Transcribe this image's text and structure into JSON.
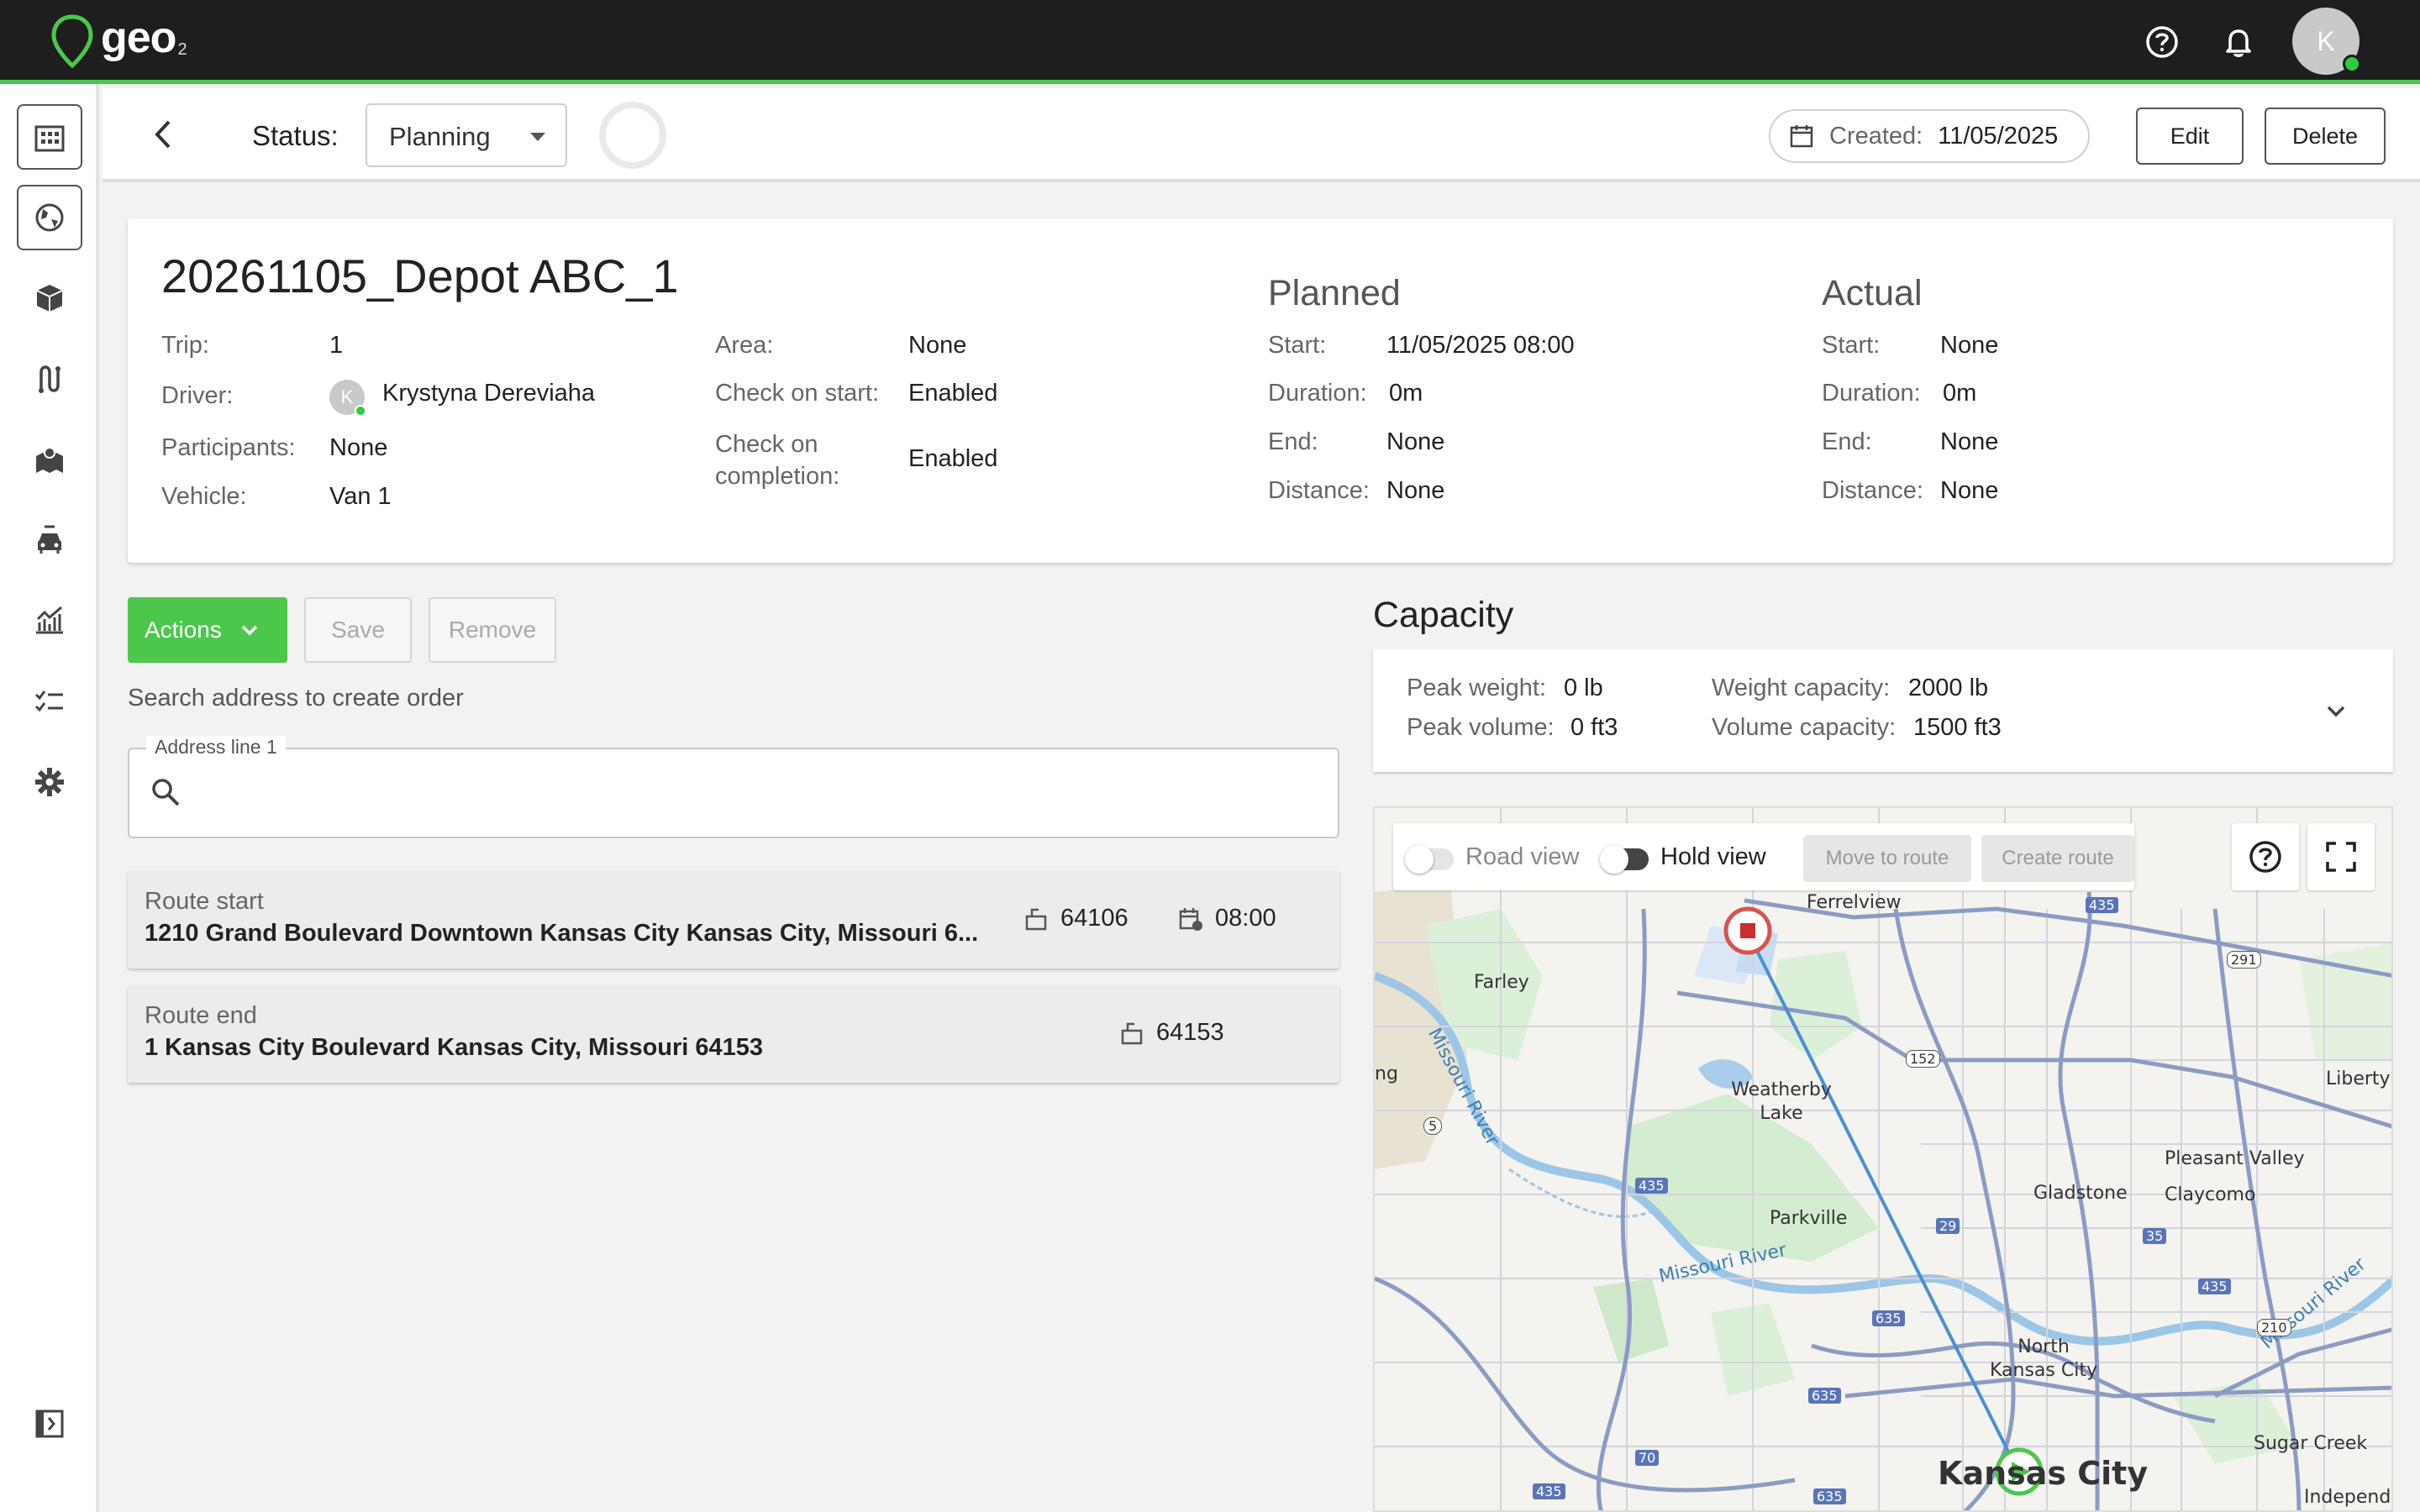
{
  "app": {
    "logo_text": "geo",
    "logo_sub": "2",
    "user_initial": "K"
  },
  "header": {
    "status_label": "Status:",
    "status_value": "Planning",
    "created_label": "Created:",
    "created_value": "11/05/2025",
    "edit_label": "Edit",
    "delete_label": "Delete"
  },
  "trip": {
    "title": "20261105_Depot ABC_1",
    "fields_left": [
      {
        "label": "Trip:",
        "value": "1"
      },
      {
        "label": "Driver:",
        "value": "Krystyna Dereviaha"
      },
      {
        "label": "Participants:",
        "value": "None"
      },
      {
        "label": "Vehicle:",
        "value": "Van 1"
      }
    ],
    "driver_initial": "K",
    "fields_mid": [
      {
        "label": "Area:",
        "value": "None"
      },
      {
        "label": "Check on start:",
        "value": "Enabled"
      },
      {
        "label": "Check on completion:",
        "value": "Enabled"
      }
    ],
    "planned": {
      "title": "Planned",
      "rows": [
        {
          "label": "Start:",
          "value": "11/05/2025 08:00"
        },
        {
          "label": "Duration:",
          "value": "0m"
        },
        {
          "label": "End:",
          "value": "None"
        },
        {
          "label": "Distance:",
          "value": "None"
        }
      ]
    },
    "actual": {
      "title": "Actual",
      "rows": [
        {
          "label": "Start:",
          "value": "None"
        },
        {
          "label": "Duration:",
          "value": "0m"
        },
        {
          "label": "End:",
          "value": "None"
        },
        {
          "label": "Distance:",
          "value": "None"
        }
      ]
    }
  },
  "order": {
    "actions_label": "Actions",
    "save_label": "Save",
    "remove_label": "Remove",
    "search_hint": "Search address to create order",
    "address_legend": "Address line 1",
    "address_value": ""
  },
  "routes": [
    {
      "label": "Route start",
      "address": "1210 Grand Boulevard Downtown Kansas City Kansas City, Missouri 6...",
      "zip": "64106",
      "time": "08:00"
    },
    {
      "label": "Route end",
      "address": "1 Kansas City Boulevard Kansas City, Missouri 64153",
      "zip": "64153"
    }
  ],
  "capacity": {
    "title": "Capacity",
    "peak_weight_label": "Peak weight:",
    "peak_weight": "0 lb",
    "peak_volume_label": "Peak volume:",
    "peak_volume": "0 ft3",
    "weight_cap_label": "Weight capacity:",
    "weight_cap": "2000 lb",
    "volume_cap_label": "Volume capacity:",
    "volume_cap": "1500 ft3"
  },
  "map": {
    "road_view_label": "Road view",
    "hold_view_label": "Hold view",
    "move_to_route_label": "Move to route",
    "create_route_label": "Create route",
    "places": [
      "Ferrelview",
      "Farley",
      "Missouri River",
      "Weatherby Lake",
      "Liberty",
      "Pleasant Valley",
      "Gladstone",
      "Claycomo",
      "Parkville",
      "Missouri River",
      "North Kansas City",
      "Sugar Creek",
      "Kansas City",
      "Independe",
      "Missouri River",
      "ng"
    ],
    "shields": [
      "435",
      "291",
      "152",
      "5",
      "435",
      "29",
      "35",
      "435",
      "635",
      "210",
      "635",
      "70",
      "435",
      "635"
    ]
  }
}
